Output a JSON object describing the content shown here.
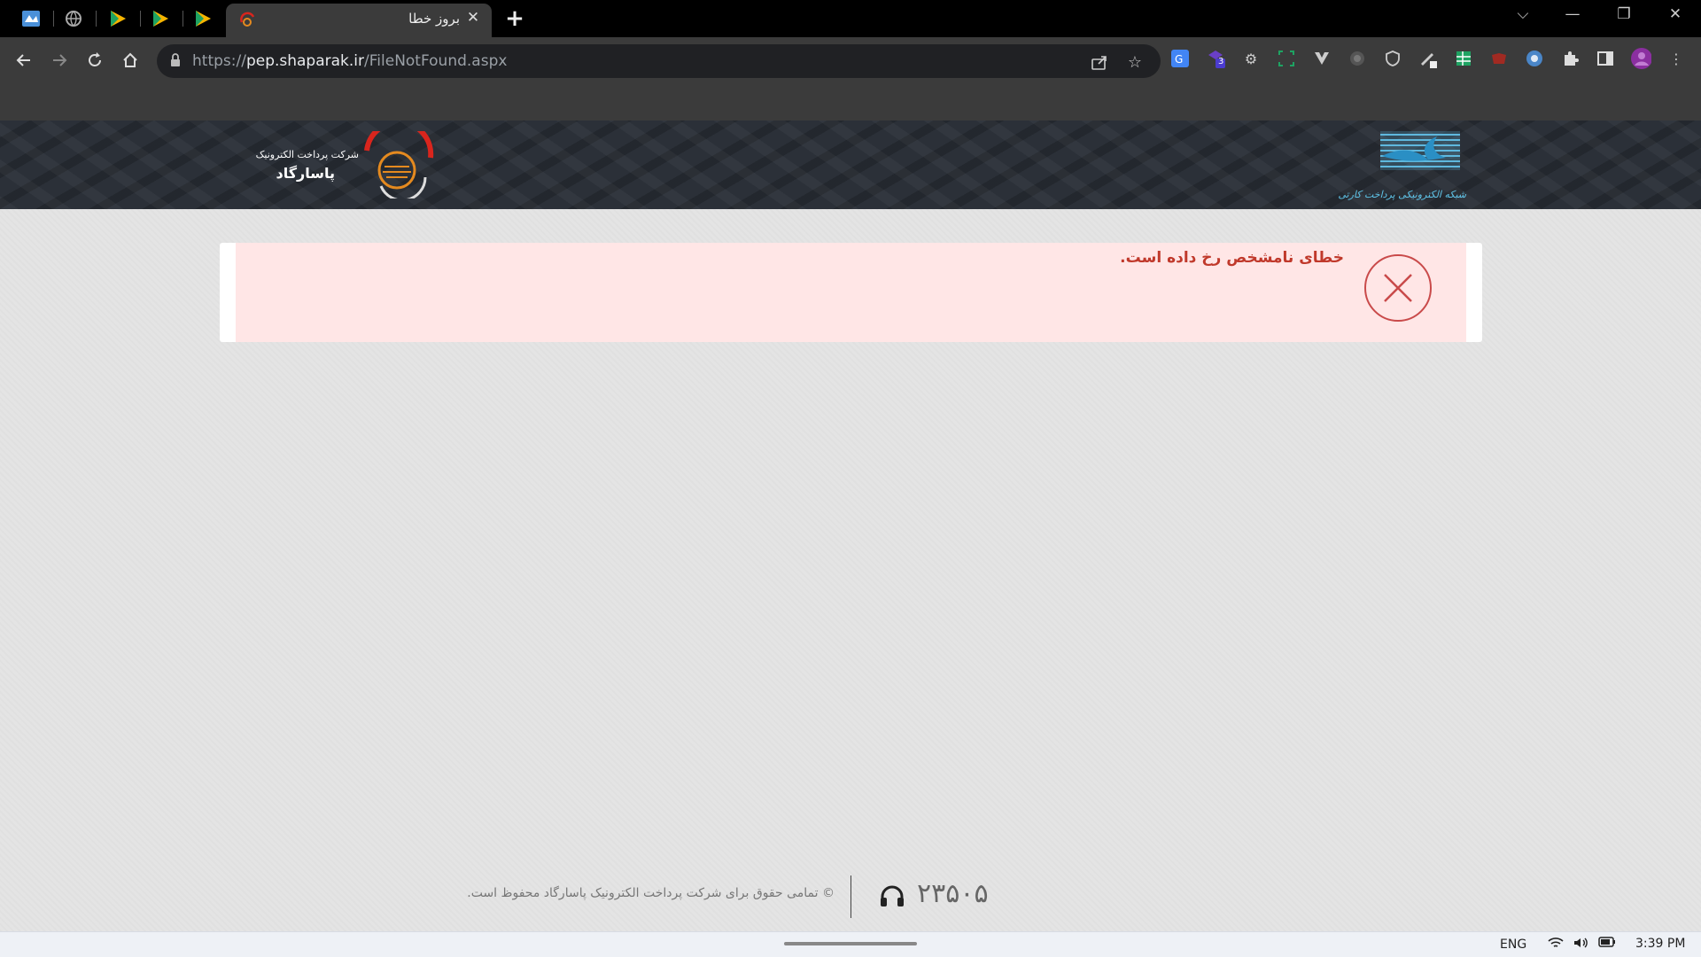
{
  "browser": {
    "active_tab": {
      "title": "بروز خطا",
      "favicon": "pasargad-favicon-icon"
    },
    "pinned_tabs": [
      "pinned-app-icon",
      "globe-icon",
      "play-icon",
      "play-icon",
      "play-icon"
    ],
    "new_tab_label": "+",
    "close_tab_label": "✕",
    "url": {
      "scheme": "https://",
      "host": "pep.shaparak.ir",
      "path": "/FileNotFound.aspx"
    },
    "extension_badge": "3",
    "window_controls": {
      "minimize": "—",
      "restore": "❐",
      "close": "✕",
      "tab_search": "⌵"
    }
  },
  "site": {
    "pep_logo_line1": "شرکت پرداخت الکترونیک",
    "pep_logo_line2": "پاسارگاد",
    "shaparak_caption": "شبکه الکترونیکی پرداخت کارتی"
  },
  "error": {
    "message": "خطای نامشخص رخ داده است."
  },
  "footer": {
    "copyright": "© تمامی حقوق برای شرکت پرداخت الکترونیک پاسارگاد محفوظ است.",
    "phone": "۲۳۵۰۵"
  },
  "taskbar": {
    "language": "ENG",
    "time": "3:39 PM"
  },
  "colors": {
    "error_text": "#c0392b",
    "error_bg": "#ffe6e6",
    "header_bg": "#2b3038"
  }
}
